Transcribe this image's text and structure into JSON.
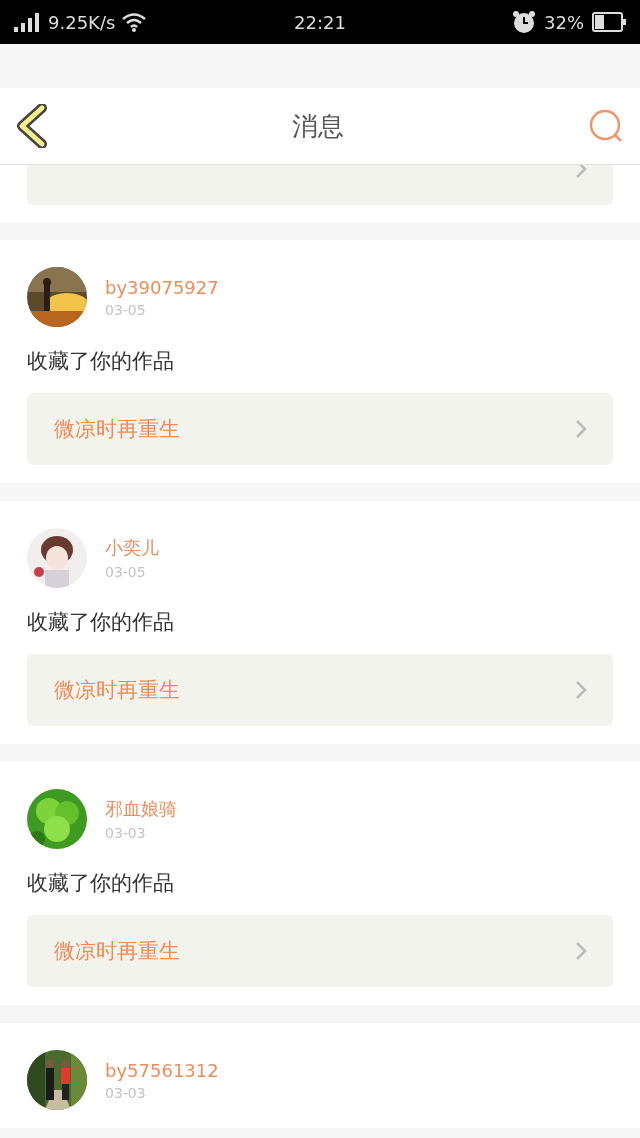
{
  "status_bar": {
    "speed": "9.25K/s",
    "time": "22:21",
    "battery": "32%"
  },
  "header": {
    "title": "消息"
  },
  "messages": [
    {
      "kind": "tail"
    },
    {
      "kind": "full",
      "user": "by39075927",
      "date": "03-05",
      "action": "收藏了你的作品",
      "work": "微凉时再重生"
    },
    {
      "kind": "full",
      "user": "小奕儿",
      "date": "03-05",
      "action": "收藏了你的作品",
      "work": "微凉时再重生"
    },
    {
      "kind": "full",
      "user": "邪血娘骑",
      "date": "03-03",
      "action": "收藏了你的作品",
      "work": "微凉时再重生"
    },
    {
      "kind": "top",
      "user": "by57561312",
      "date": "03-03"
    }
  ]
}
